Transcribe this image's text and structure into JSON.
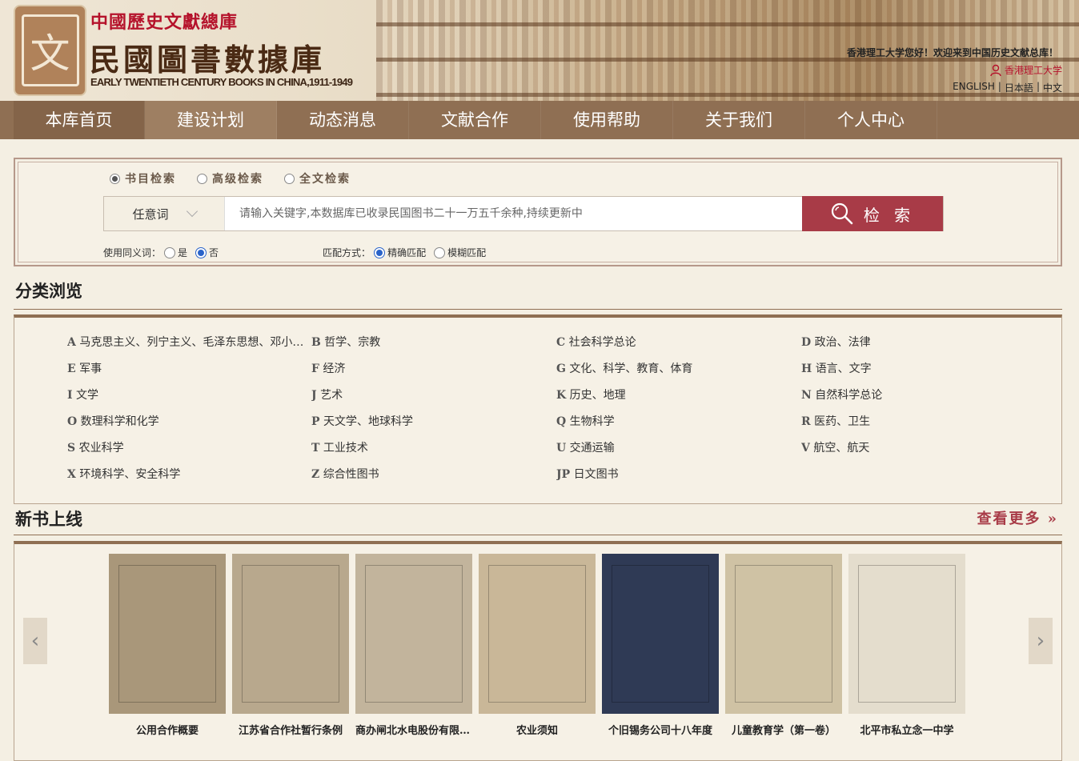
{
  "header": {
    "brand_top": "中國歷史文獻總庫",
    "brand_main": "民國圖書數據庫",
    "brand_en": "EARLY TWENTIETH CENTURY BOOKS IN CHINA,1911-1949",
    "welcome": "香港理工大学您好！欢迎来到中国历史文献总库！",
    "user": "香港理工大学",
    "languages": [
      "ENGLISH",
      "日本語",
      "中文"
    ]
  },
  "nav": {
    "items": [
      "本库首页",
      "建设计划",
      "动态消息",
      "文献合作",
      "使用帮助",
      "关于我们",
      "个人中心"
    ],
    "active": "建设计划"
  },
  "search": {
    "modes": [
      "书目检索",
      "高级检索",
      "全文检索"
    ],
    "selected_mode": "书目检索",
    "field": "任意词",
    "placeholder": "请输入关键字,本数据库已收录民国图书二十一万五千余种,持续更新中",
    "button": "检 索",
    "synonym_label": "使用同义词：",
    "synonym_yes": "是",
    "synonym_no": "否",
    "synonym_selected": "否",
    "match_label": "匹配方式：",
    "match_exact": "精确匹配",
    "match_fuzzy": "模糊匹配",
    "match_selected": "精确匹配"
  },
  "categories": {
    "title": "分类浏览",
    "items": [
      {
        "code": "A",
        "name": "马克思主义、列宁主义、毛泽东思想、邓小平理论"
      },
      {
        "code": "B",
        "name": "哲学、宗教"
      },
      {
        "code": "C",
        "name": "社会科学总论"
      },
      {
        "code": "D",
        "name": "政治、法律"
      },
      {
        "code": "E",
        "name": "军事"
      },
      {
        "code": "F",
        "name": "经济"
      },
      {
        "code": "G",
        "name": "文化、科学、教育、体育"
      },
      {
        "code": "H",
        "name": "语言、文字"
      },
      {
        "code": "I",
        "name": "文学"
      },
      {
        "code": "J",
        "name": "艺术"
      },
      {
        "code": "K",
        "name": "历史、地理"
      },
      {
        "code": "N",
        "name": "自然科学总论"
      },
      {
        "code": "O",
        "name": "数理科学和化学"
      },
      {
        "code": "P",
        "name": "天文学、地球科学"
      },
      {
        "code": "Q",
        "name": "生物科学"
      },
      {
        "code": "R",
        "name": "医药、卫生"
      },
      {
        "code": "S",
        "name": "农业科学"
      },
      {
        "code": "T",
        "name": "工业技术"
      },
      {
        "code": "U",
        "name": "交通运输"
      },
      {
        "code": "V",
        "name": "航空、航天"
      },
      {
        "code": "X",
        "name": "环境科学、安全科学"
      },
      {
        "code": "Z",
        "name": "综合性图书"
      },
      {
        "code": "JP",
        "name": "日文图书"
      }
    ]
  },
  "new_books": {
    "title": "新书上线",
    "more": "查看更多",
    "items": [
      {
        "title": "公用合作概要",
        "cover_color": "#a9977a"
      },
      {
        "title": "江苏省合作社暂行条例",
        "cover_color": "#b8a88d"
      },
      {
        "title": "商办闸北水电股份有限公司",
        "cover_color": "#c2b49c"
      },
      {
        "title": "农业须知",
        "cover_color": "#c9b798"
      },
      {
        "title": "个旧锡务公司十八年度",
        "cover_color": "#2f3a55"
      },
      {
        "title": "儿童教育学（第一卷）",
        "cover_color": "#cfc2a4"
      },
      {
        "title": "北平市私立念一中学",
        "cover_color": "#e4ddcd"
      }
    ]
  }
}
